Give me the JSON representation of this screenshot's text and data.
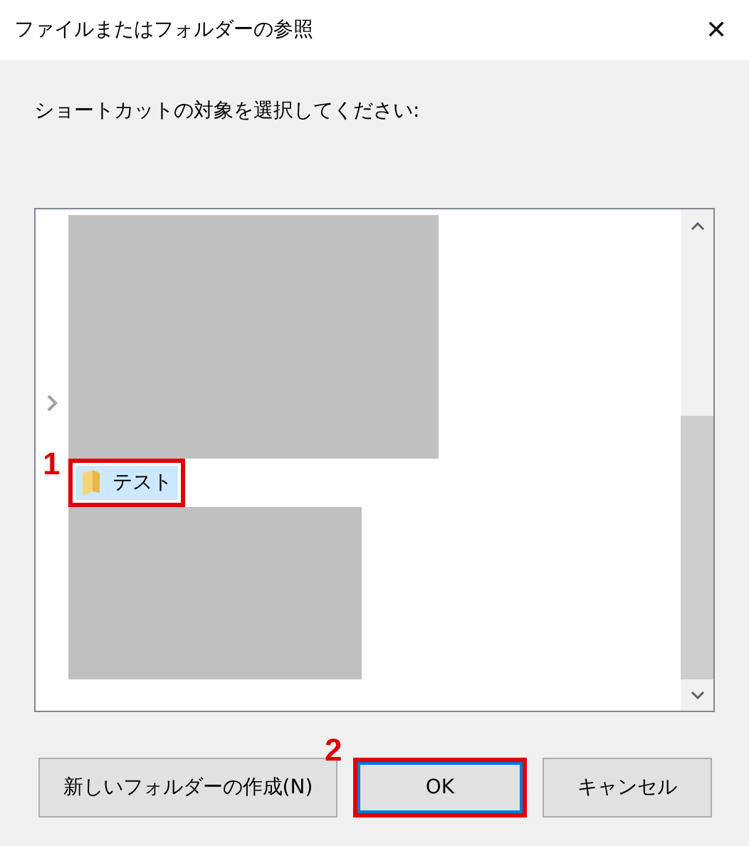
{
  "window": {
    "title": "ファイルまたはフォルダーの参照",
    "close": "✕"
  },
  "instruction": "ショートカットの対象を選択してください:",
  "tree": {
    "items": [
      {
        "label": "テスト",
        "selected": true,
        "highlighted": true,
        "callout": "1"
      }
    ]
  },
  "buttons": [
    {
      "label": "新しいフォルダーの作成(N)",
      "default": false,
      "highlighted": false
    },
    {
      "label": "OK",
      "default": true,
      "highlighted": true,
      "callout": "2"
    },
    {
      "label": "キャンセル",
      "default": false,
      "highlighted": false
    }
  ]
}
